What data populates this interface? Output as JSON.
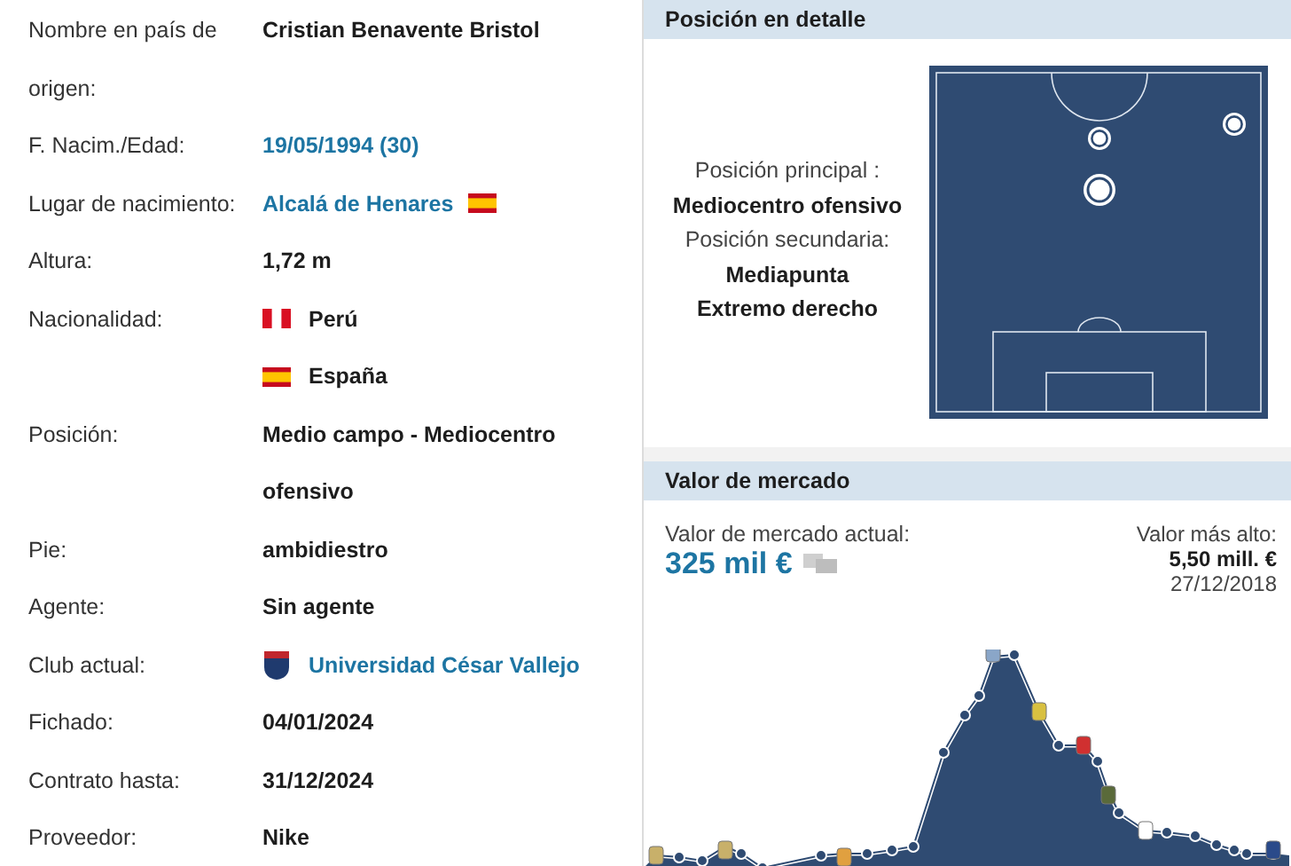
{
  "player_data": [
    {
      "label": "Nombre en país de origen:",
      "values": [
        {
          "kind": "text",
          "text": "Cristian Benavente Bristol"
        }
      ]
    },
    {
      "label": "F. Nacim./Edad:",
      "values": [
        {
          "kind": "link",
          "text": "19/05/1994 (30)"
        }
      ]
    },
    {
      "label": "Lugar de nacimiento:",
      "values": [
        {
          "kind": "link-flag-spain",
          "text": "Alcalá de Henares"
        }
      ]
    },
    {
      "label": "Altura:",
      "values": [
        {
          "kind": "text",
          "text": "1,72 m"
        }
      ]
    },
    {
      "label": "Nacionalidad:",
      "values": [
        {
          "kind": "flag-peru",
          "text": "Perú"
        },
        {
          "kind": "flag-spain",
          "text": "España"
        }
      ]
    },
    {
      "label": "Posición:",
      "values": [
        {
          "kind": "text",
          "text": "Medio campo - Mediocentro ofensivo"
        }
      ]
    },
    {
      "label": "Pie:",
      "values": [
        {
          "kind": "text",
          "text": "ambidiestro"
        }
      ]
    },
    {
      "label": "Agente:",
      "values": [
        {
          "kind": "text",
          "text": "Sin agente"
        }
      ]
    },
    {
      "label": "Club actual:",
      "values": [
        {
          "kind": "crest-link",
          "text": "Universidad César Vallejo"
        }
      ]
    },
    {
      "label": "Fichado:",
      "values": [
        {
          "kind": "text",
          "text": "04/01/2024"
        }
      ]
    },
    {
      "label": "Contrato hasta:",
      "values": [
        {
          "kind": "text",
          "text": "31/12/2024"
        }
      ]
    },
    {
      "label": "Proveedor:",
      "values": [
        {
          "kind": "text",
          "text": "Nike"
        }
      ]
    }
  ],
  "position_detail": {
    "title": "Posición en detalle",
    "main_label": "Posición principal :",
    "main": "Mediocentro ofensivo",
    "secondary_label": "Posición secundaria:",
    "secondary": [
      "Mediapunta",
      "Extremo derecho"
    ]
  },
  "market_value": {
    "title": "Valor de mercado",
    "current_label": "Valor de mercado actual:",
    "current": "325 mil €",
    "highest_label": "Valor más alto:",
    "highest": "5,50 mill. €",
    "highest_date": "27/12/2018"
  }
}
